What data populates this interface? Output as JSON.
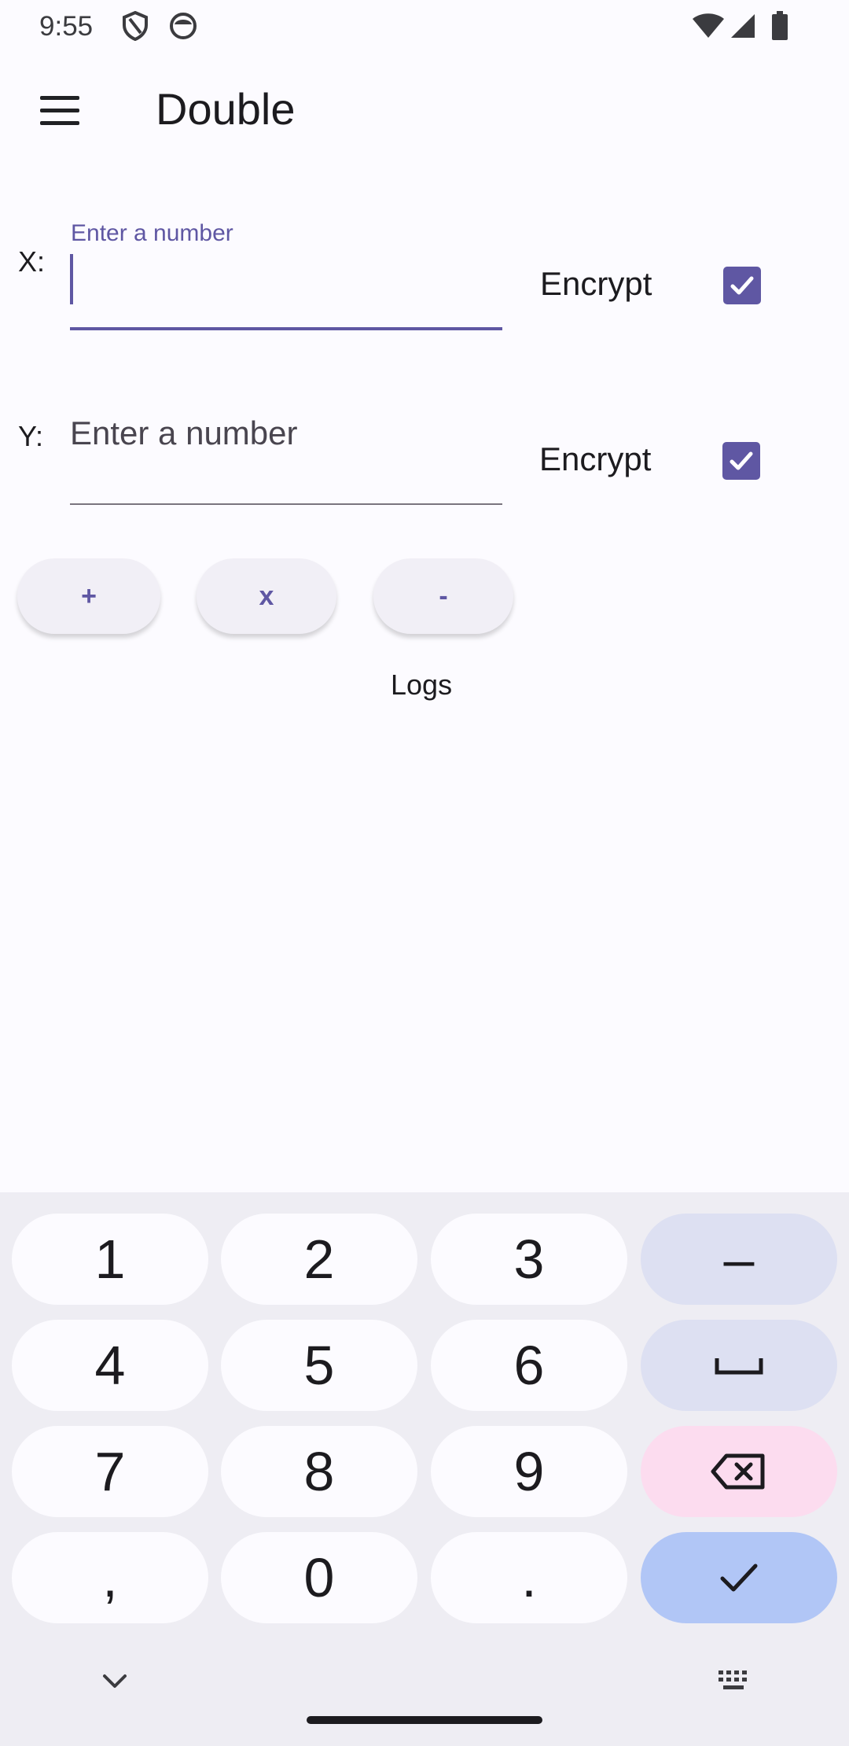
{
  "status_bar": {
    "time": "9:55",
    "icons": [
      "shield-icon",
      "face-icon",
      "wifi-icon",
      "signal-icon",
      "battery-icon"
    ]
  },
  "app_bar": {
    "title": "Double",
    "menu_icon": "hamburger-menu-icon"
  },
  "form": {
    "x": {
      "label": "X:",
      "floating_label": "Enter a number",
      "value": "",
      "focused": true,
      "encrypt_label": "Encrypt",
      "encrypt_checked": true
    },
    "y": {
      "label": "Y:",
      "placeholder": "Enter a number",
      "value": "",
      "focused": false,
      "encrypt_label": "Encrypt",
      "encrypt_checked": true
    }
  },
  "operations": [
    "+",
    "x",
    "-"
  ],
  "logs_label": "Logs",
  "keyboard": {
    "rows": [
      [
        "1",
        "2",
        "3",
        "–"
      ],
      [
        "4",
        "5",
        "6",
        "space-icon"
      ],
      [
        "7",
        "8",
        "9",
        "backspace-icon"
      ],
      [
        ",",
        "0",
        ".",
        "check-icon"
      ]
    ],
    "bottom": [
      "chevron-down-icon",
      "keyboard-icon"
    ]
  },
  "colors": {
    "accent": "#5f57a3",
    "background": "#fcfbff",
    "keyboard_bg": "#eeedf3",
    "key_bg": "#fcfbff",
    "function_key": "#dde0f2",
    "delete_key": "#fcdcef",
    "enter_key": "#b1c6f6"
  }
}
